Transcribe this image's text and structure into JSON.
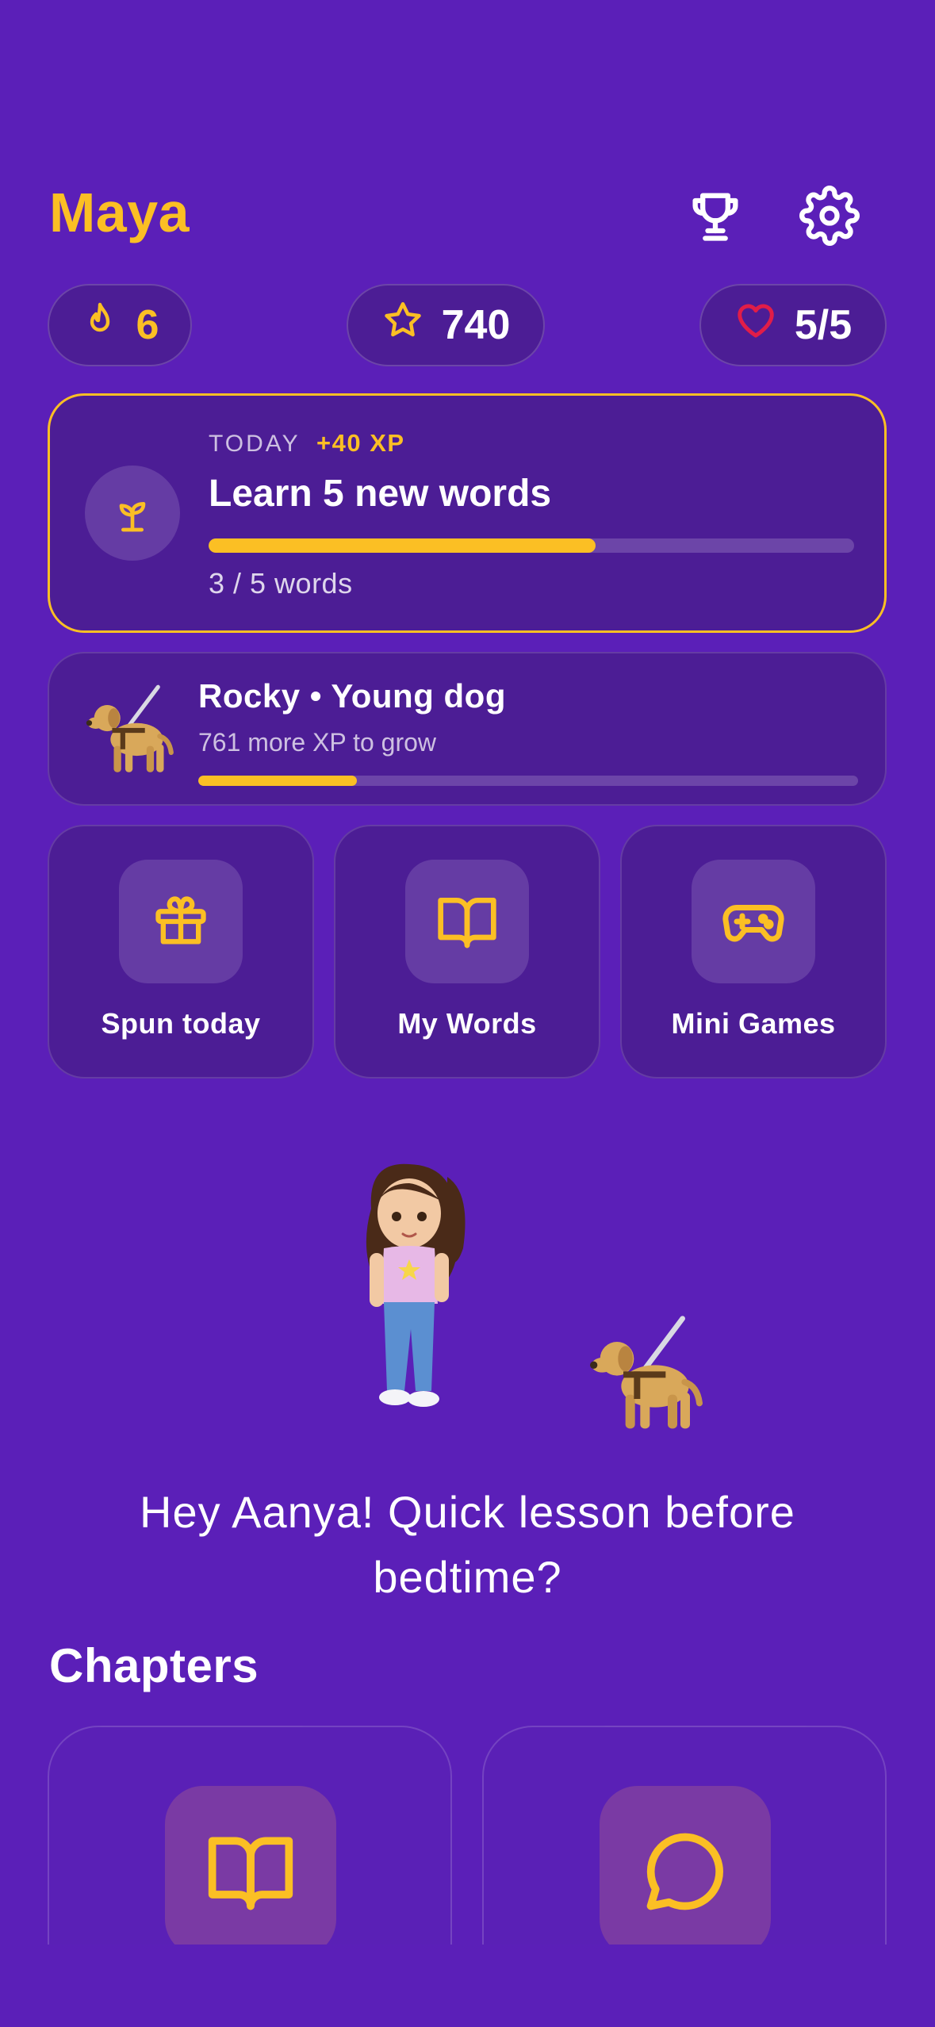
{
  "header": {
    "title": "Maya"
  },
  "stats": {
    "streak": "6",
    "stars": "740",
    "hearts": "5/5"
  },
  "daily_goal": {
    "label": "TODAY",
    "xp": "+40 XP",
    "title": "Learn 5 new words",
    "progress_text": "3 / 5 words",
    "progress": 0.6
  },
  "pet": {
    "title": "Rocky • Young dog",
    "subtitle": "761 more XP to grow",
    "progress": 0.24
  },
  "tiles": [
    {
      "label": "Spun today",
      "icon": "gift-icon"
    },
    {
      "label": "My Words",
      "icon": "book-open-icon"
    },
    {
      "label": "Mini Games",
      "icon": "gamepad-icon"
    }
  ],
  "greeting": {
    "line1": "Hey Aanya! Quick lesson before",
    "line2": "bedtime?"
  },
  "chapters": {
    "heading": "Chapters",
    "items": [
      {
        "icon": "book-open-icon"
      },
      {
        "icon": "chat-bubble-icon"
      }
    ]
  },
  "colors": {
    "background": "#5b1fb8",
    "accent": "#fbbf24",
    "card": "#4c1d95",
    "heart": "#e11d48"
  }
}
